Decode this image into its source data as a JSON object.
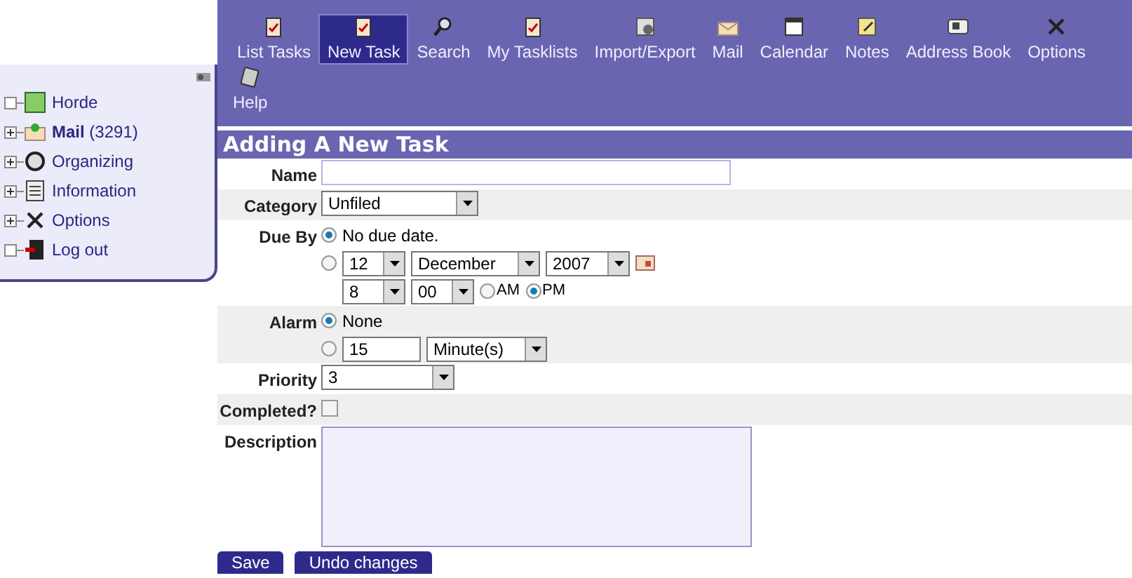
{
  "toolbar": {
    "items": [
      {
        "label": "List Tasks",
        "selected": false
      },
      {
        "label": "New Task",
        "selected": true
      },
      {
        "label": "Search",
        "selected": false
      },
      {
        "label": "My Tasklists",
        "selected": false
      },
      {
        "label": "Import/Export",
        "selected": false
      },
      {
        "label": "Mail",
        "selected": false
      },
      {
        "label": "Calendar",
        "selected": false
      },
      {
        "label": "Notes",
        "selected": false
      },
      {
        "label": "Address Book",
        "selected": false
      },
      {
        "label": "Options",
        "selected": false
      },
      {
        "label": "Help",
        "selected": false
      }
    ]
  },
  "sidebar": {
    "items": [
      {
        "label": "Horde",
        "expandable": false
      },
      {
        "label": "**Mail** (3291)",
        "expandable": true
      },
      {
        "label": "Organizing",
        "expandable": true
      },
      {
        "label": "Information",
        "expandable": true
      },
      {
        "label": "Options",
        "expandable": true
      },
      {
        "label": "Log out",
        "expandable": false
      }
    ]
  },
  "form": {
    "title": "Adding A New Task",
    "name": {
      "label": "Name"
    },
    "category": {
      "label": "Category",
      "value": "Unfiled"
    },
    "due_by": {
      "label": "Due By",
      "options": [
        {
          "kind": "none",
          "label": "No due date.",
          "selected": true
        },
        {
          "kind": "date",
          "selected": false,
          "day": "12",
          "month": "December",
          "year": "2007",
          "hour": "8",
          "minute": "00",
          "ampm": [
            {
              "label": "AM",
              "selected": false
            },
            {
              "label": "PM",
              "selected": true
            }
          ]
        }
      ]
    },
    "alarm": {
      "label": "Alarm",
      "options": [
        {
          "kind": "none",
          "label": "None",
          "selected": true
        },
        {
          "kind": "time",
          "selected": false,
          "value": "15",
          "unit": "Minute(s)"
        }
      ]
    },
    "priority": {
      "label": "Priority",
      "value": "3"
    },
    "completed": {
      "label": "Completed?",
      "checked": false
    },
    "description": {
      "label": "Description"
    },
    "buttons": [
      "Save",
      "Undo changes"
    ]
  }
}
